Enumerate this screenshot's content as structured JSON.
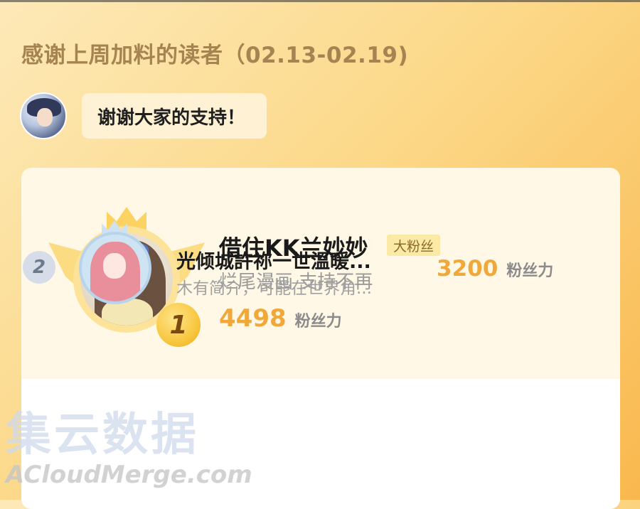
{
  "header": {
    "title": "感谢上周加料的读者（02.13-02.19)"
  },
  "author_message": {
    "avatar_icon": "author-avatar",
    "text": "谢谢大家的支持！"
  },
  "leaderboard": {
    "top": {
      "rank": "1",
      "name": "借住KK兰妙妙",
      "tag": "大粉丝",
      "description": "烂尾漫画 支持不再",
      "score": "4498",
      "score_unit": "粉丝力"
    },
    "second": {
      "rank": "2",
      "name": "光倾城許祢一世溫暖...",
      "description": "木有简介，可能在世界角...",
      "score": "3200",
      "score_unit": "粉丝力"
    }
  },
  "watermark": {
    "cn": "集云数据",
    "en": "ACloudMerge.com"
  },
  "colors": {
    "accent": "#f1a83a",
    "title": "#a58452",
    "card": "#fff8e6"
  }
}
